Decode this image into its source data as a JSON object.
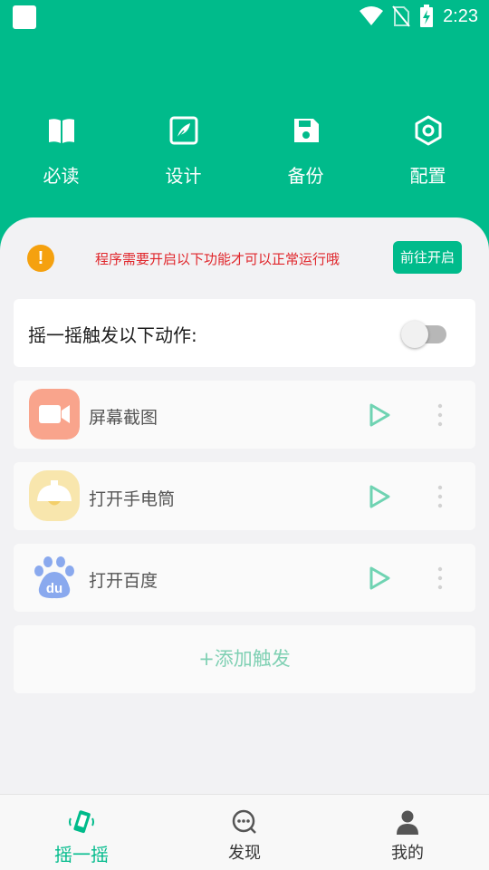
{
  "status_bar": {
    "time": "2:23",
    "icons": [
      "wifi-icon",
      "no-sim-icon",
      "battery-charging-icon"
    ]
  },
  "quick_actions": [
    {
      "label": "必读",
      "icon": "book-icon"
    },
    {
      "label": "设计",
      "icon": "design-edit-icon"
    },
    {
      "label": "备份",
      "icon": "save-disk-icon"
    },
    {
      "label": "配置",
      "icon": "settings-hexagon-icon"
    }
  ],
  "notice": {
    "icon": "warning-icon",
    "icon_glyph": "!",
    "text": "程序需要开启以下功能才可以正常运行哦",
    "button_label": "前往开启"
  },
  "shake": {
    "label": "摇一摇触发以下动作:",
    "enabled": false
  },
  "actions": [
    {
      "label": "屏幕截图",
      "icon": "video-camera-icon"
    },
    {
      "label": "打开手电筒",
      "icon": "lamp-icon"
    },
    {
      "label": "打开百度",
      "icon": "baidu-paw-icon",
      "icon_text": "du"
    }
  ],
  "add_label": "+添加触发",
  "tabs": [
    {
      "label": "摇一摇",
      "icon": "shake-phone-icon",
      "active": true
    },
    {
      "label": "发现",
      "icon": "chat-search-icon",
      "active": false
    },
    {
      "label": "我的",
      "icon": "user-icon",
      "active": false
    }
  ],
  "colors": {
    "brand": "#00bb8b",
    "warning": "#f5a10f",
    "notice_text": "#e0262b",
    "play": "#6fd3b2"
  }
}
